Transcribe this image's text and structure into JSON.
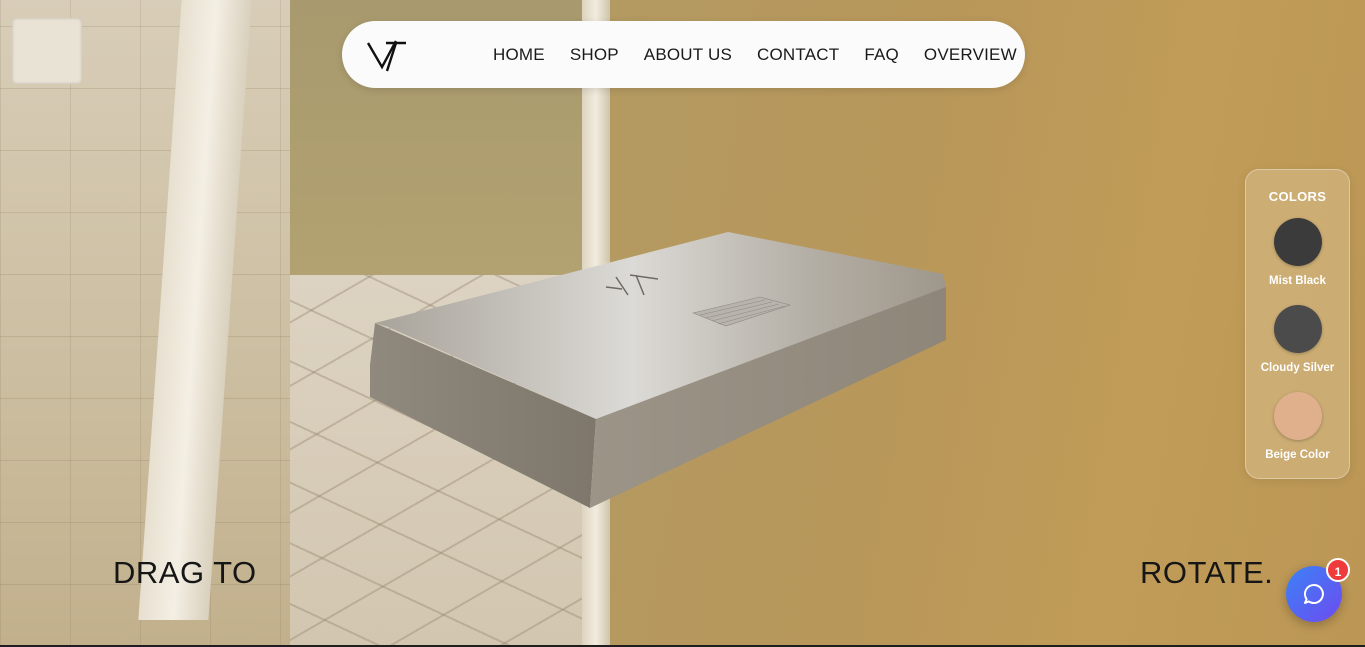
{
  "nav": {
    "links": [
      {
        "label": "HOME"
      },
      {
        "label": "SHOP"
      },
      {
        "label": "ABOUT US"
      },
      {
        "label": "CONTACT"
      },
      {
        "label": "FAQ"
      },
      {
        "label": "OVERVIEW"
      }
    ],
    "logo_icon": "vt-logo-icon"
  },
  "colors_panel": {
    "title": "COLORS",
    "options": [
      {
        "label": "Mist Black",
        "color": "#3b3b3c"
      },
      {
        "label": "Cloudy Silver",
        "color": "#4b4b4b"
      },
      {
        "label": "Beige Color",
        "color": "#e0b08c"
      }
    ]
  },
  "hero": {
    "left_text": "DRAG TO",
    "right_text": "ROTATE."
  },
  "chat": {
    "icon": "chat-bubble-icon",
    "badge_count": "1",
    "gradient_start": "#3b82f6",
    "gradient_end": "#6d4bf0",
    "badge_color": "#ef3b3b"
  },
  "colors": {
    "nav_bg": "#fbfbfb",
    "text_dark": "#161616"
  }
}
